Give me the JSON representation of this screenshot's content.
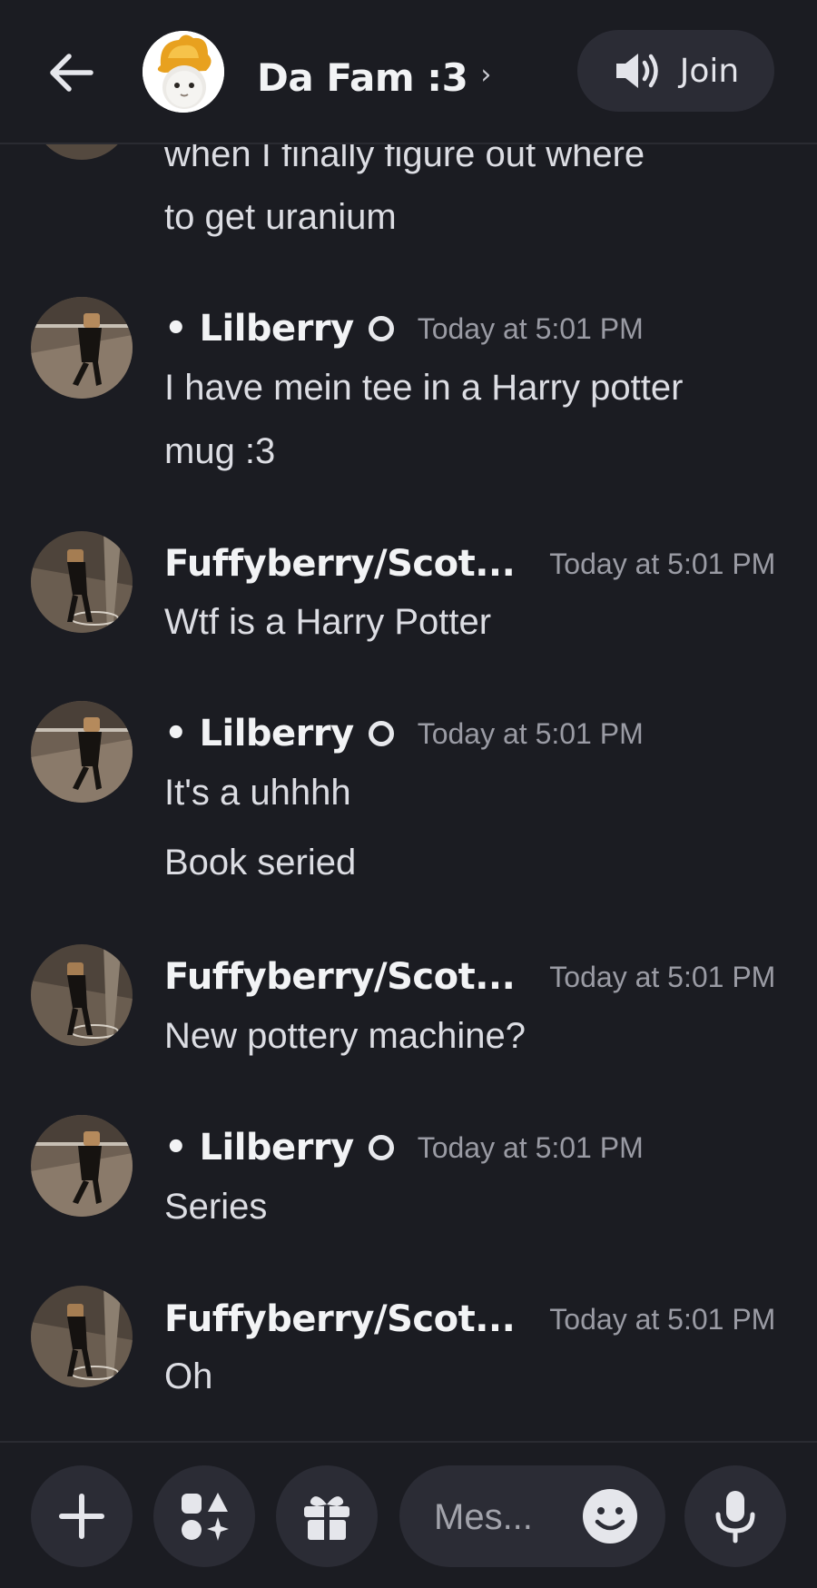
{
  "header": {
    "group_name": "Da Fam :3",
    "chevron": "›",
    "join_label": "Join",
    "icons": {
      "back": "arrow-left-icon",
      "voice": "speaker-icon"
    }
  },
  "partial_message": {
    "lines": [
      "when I finally figure out where",
      "to get uranium"
    ]
  },
  "messages": [
    {
      "author": "• Lilberry",
      "timestamp": "Today at 5:01 PM",
      "lines": [
        "I have mein tee in a Harry potter",
        "mug :3"
      ]
    },
    {
      "author": "Fuffyberry/Scot...",
      "timestamp": "Today at 5:01 PM",
      "lines": [
        "Wtf is a Harry Potter"
      ]
    },
    {
      "author": "• Lilberry",
      "timestamp": "Today at 5:01 PM",
      "lines": [
        "It's a uhhhh",
        "Book seried"
      ]
    },
    {
      "author": "Fuffyberry/Scot...",
      "timestamp": "Today at 5:01 PM",
      "lines": [
        "New pottery machine?"
      ]
    },
    {
      "author": "• Lilberry",
      "timestamp": "Today at 5:01 PM",
      "lines": [
        "Series"
      ]
    },
    {
      "author": "Fuffyberry/Scot...",
      "timestamp": "Today at 5:01 PM",
      "lines": [
        "Oh"
      ]
    }
  ],
  "composer": {
    "placeholder": "Mes...",
    "icons": {
      "add": "plus-icon",
      "apps": "apps-icon",
      "gift": "gift-icon",
      "emoji": "emoji-icon",
      "mic": "microphone-icon"
    }
  },
  "colors": {
    "background": "#1b1c22",
    "surface": "#2b2c35",
    "text": "#dcdde3",
    "muted": "#9a9ba4"
  }
}
